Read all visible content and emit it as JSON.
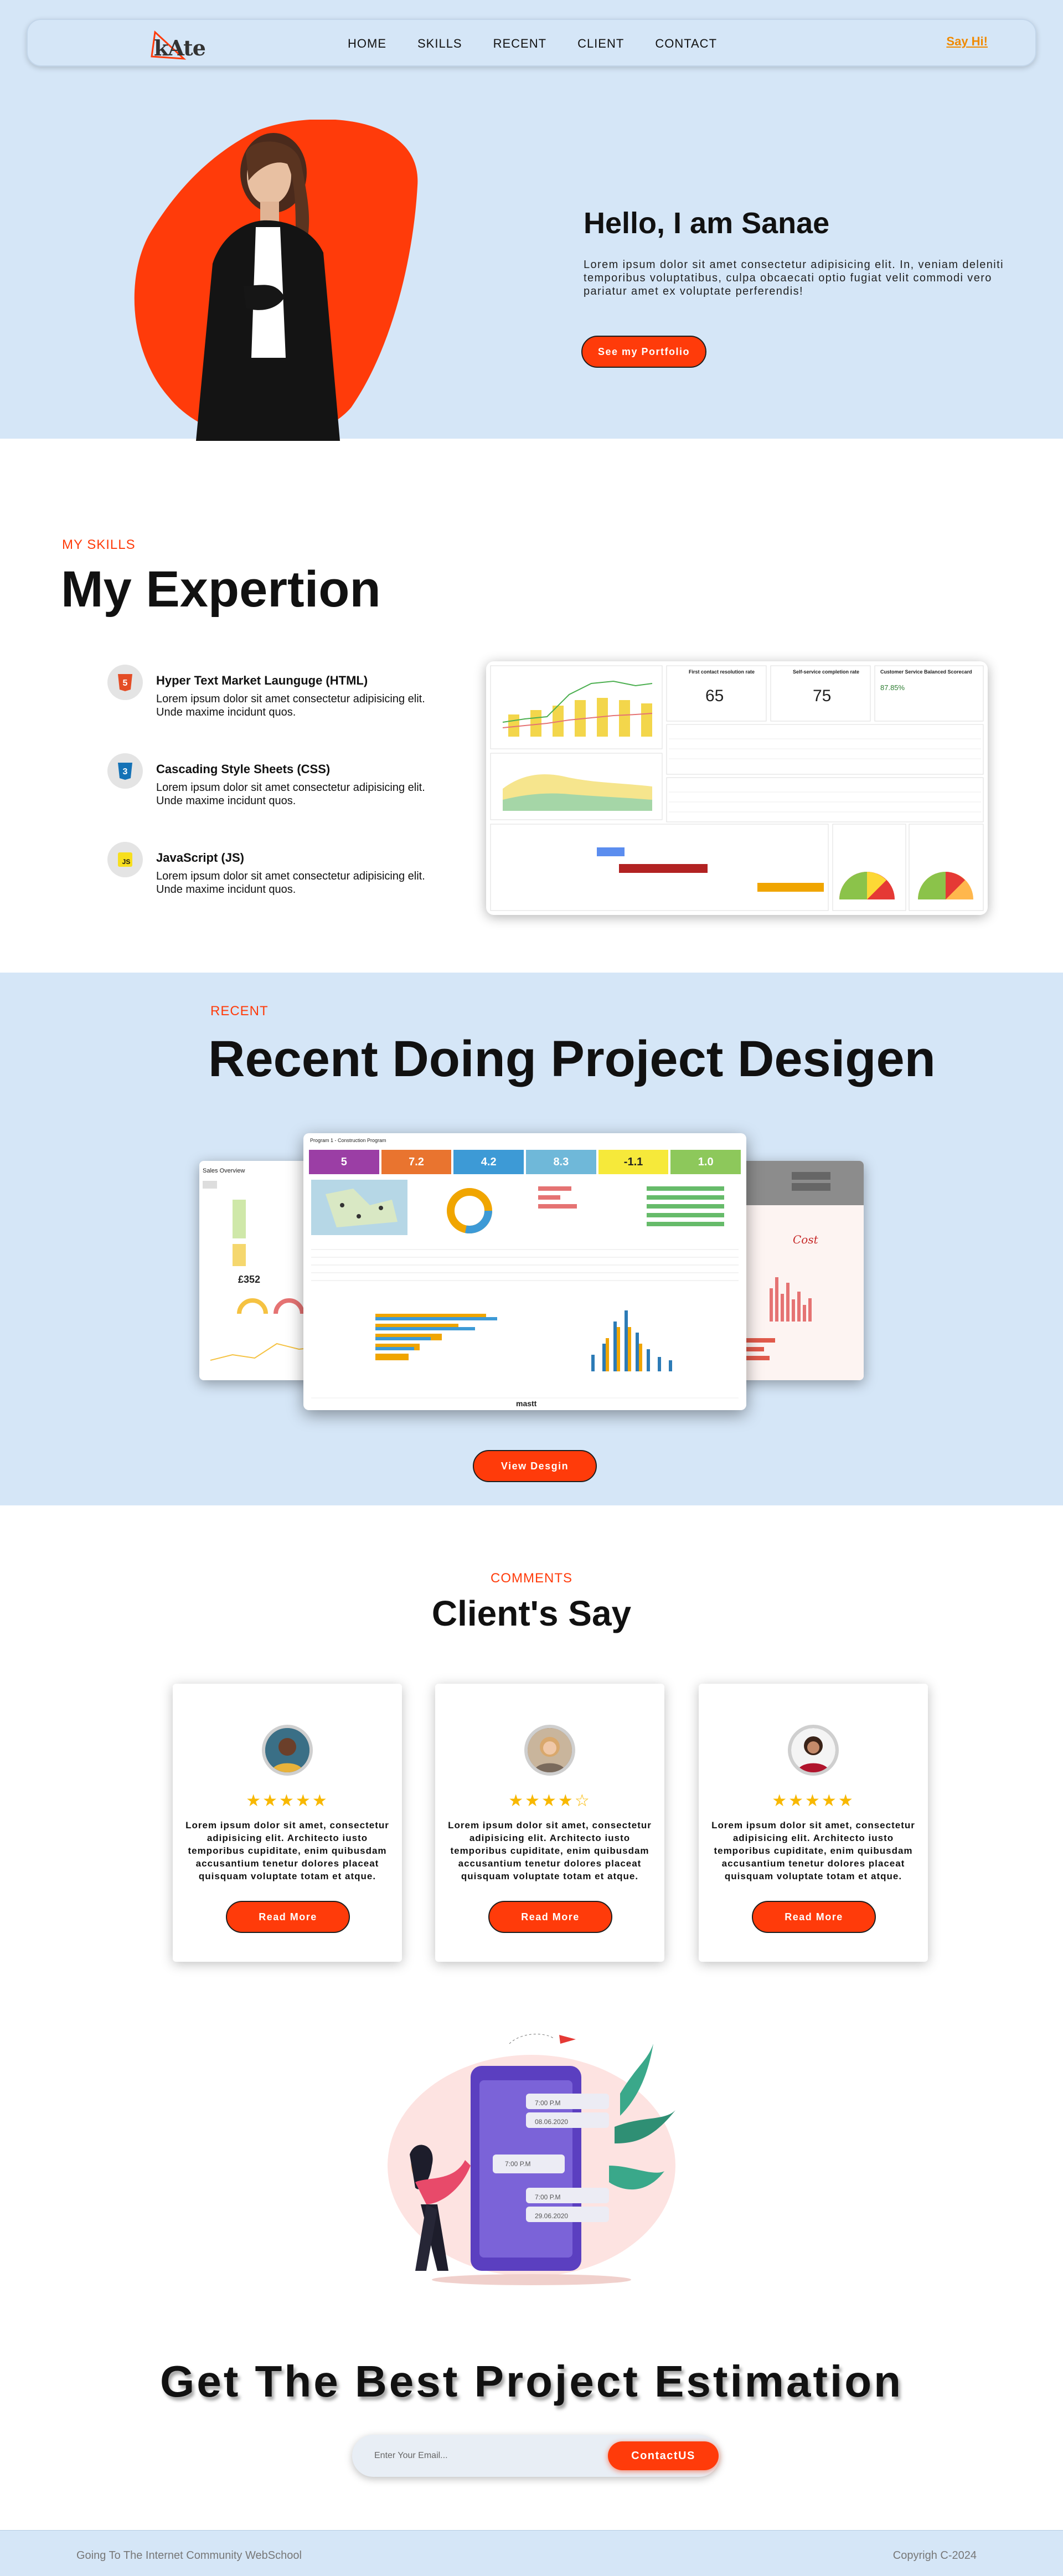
{
  "nav": {
    "logo": "kAte",
    "links": [
      "HOME",
      "SKILLS",
      "RECENT",
      "CLIENT",
      "CONTACT"
    ],
    "say_hi": "Say Hi!"
  },
  "hero": {
    "title": "Hello, I am Sanae",
    "text": "Lorem ipsum dolor sit amet consectetur adipisicing elit. In, veniam deleniti temporibus voluptatibus, culpa obcaecati optio fugiat velit commodi vero pariatur amet ex voluptate perferendis!",
    "button": "See my Portfolio",
    "blob_color": "#ff3b0a",
    "bg_color": "#d5e6f7"
  },
  "skills": {
    "kicker": "MY SKILLS",
    "title": "My Expertion",
    "items": [
      {
        "name": "Hyper Text Market Launguge (HTML)",
        "icon": "html5-icon",
        "icon_label": "5",
        "desc": "Lorem ipsum dolor sit amet consectetur adipisicing elit. Unde maxime incidunt quos."
      },
      {
        "name": "Cascading Style Sheets (CSS)",
        "icon": "css3-icon",
        "icon_label": "3",
        "desc": "Lorem ipsum dolor sit amet consectetur adipisicing elit. Unde maxime incidunt quos."
      },
      {
        "name": "JavaScript (JS)",
        "icon": "js-icon",
        "icon_label": "JS",
        "desc": "Lorem ipsum dolor sit amet consectetur adipisicing elit. Unde maxime incidunt quos."
      }
    ],
    "dashboard": {
      "kpi1_label": "First contact resolution rate",
      "kpi1_value": "65",
      "kpi2_label": "Self-service completion rate",
      "kpi2_value": "75",
      "kpi3_label": "Customer Service Balanced Scorecard",
      "kpi3_value": "87.85%"
    }
  },
  "recent": {
    "kicker": "RECENT",
    "title": "Recent Doing Project Desigen",
    "button": "View Desgin",
    "main_shot": {
      "header": "Program 1 - Construction Program",
      "kpis": [
        "5",
        "7.2",
        "4.2",
        "8.3",
        "-1.1",
        "1.0"
      ],
      "kpi_colors": [
        "#9b3ea5",
        "#e9742f",
        "#3d9ad6",
        "#6fb8d9",
        "#f6e93a",
        "#8dc85b"
      ],
      "footer": "mastt"
    },
    "left_shot": {
      "title": "Sales Overview",
      "value": "£352"
    },
    "right_shot": {
      "title": "Cost"
    }
  },
  "clients": {
    "kicker": "COMMENTS",
    "title": "Client's Say",
    "cards": [
      {
        "stars": "★★★★★",
        "text": "Lorem ipsum dolor sit amet, consectetur adipisicing elit. Architecto iusto temporibus cupiditate, enim quibusdam accusantium tenetur dolores placeat quisquam voluptate totam et atque.",
        "button": "Read More"
      },
      {
        "stars": "★★★★☆",
        "text": "Lorem ipsum dolor sit amet, consectetur adipisicing elit. Architecto iusto temporibus cupiditate, enim quibusdam accusantium tenetur dolores placeat quisquam voluptate totam et atque.",
        "button": "Read More"
      },
      {
        "stars": "★★★★★",
        "text": "Lorem ipsum dolor sit amet, consectetur adipisicing elit. Architecto iusto temporibus cupiditate, enim quibusdam accusantium tenetur dolores placeat quisquam voluptate totam et atque.",
        "button": "Read More"
      }
    ]
  },
  "estimation": {
    "title": "Get The Best Project Estimation",
    "placeholder": "Enter Your Email...",
    "button": "ContactUS",
    "phone_times": [
      "7:00 P.M",
      "08.06.2020",
      "7:00 P.M",
      "7:00 P.M",
      "29.06.2020"
    ]
  },
  "footer": {
    "left": "Going To The Internet Community WebSchool",
    "right": "Copyrigh C-2024"
  }
}
